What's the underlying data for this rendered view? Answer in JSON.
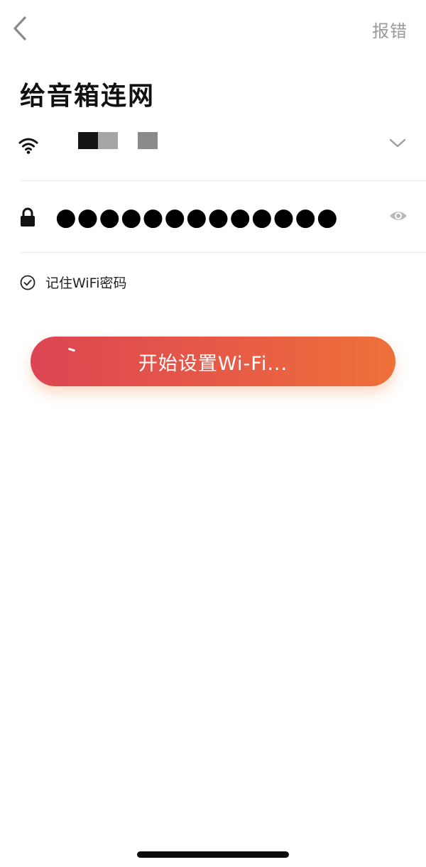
{
  "header": {
    "back_icon": "chevron-left-icon",
    "report_label": "报错"
  },
  "page": {
    "title": "给音箱连网"
  },
  "wifi": {
    "icon": "wifi-icon",
    "ssid_obscured": true,
    "dropdown_icon": "chevron-down-icon"
  },
  "password": {
    "icon": "lock-icon",
    "masked_value": "●●●●●●●●●●●●●",
    "visibility_icon": "eye-icon"
  },
  "remember": {
    "checked": true,
    "label": "记住WiFi密码"
  },
  "action": {
    "label": "开始设置Wi-Fi...",
    "loading": true
  },
  "colors": {
    "accent_start": "#dd4452",
    "accent_end": "#ee7138",
    "muted_text": "#9a9a9a",
    "divider": "#ececec"
  }
}
